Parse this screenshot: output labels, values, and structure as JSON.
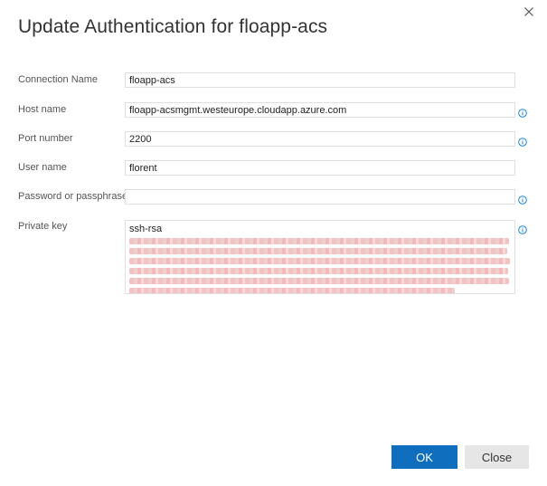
{
  "dialog": {
    "title": "Update Authentication for floapp-acs",
    "close_icon": "close-icon"
  },
  "fields": {
    "connection_name": {
      "label": "Connection Name",
      "value": "floapp-acs"
    },
    "host_name": {
      "label": "Host name",
      "value": "floapp-acsmgmt.westeurope.cloudapp.azure.com"
    },
    "port_number": {
      "label": "Port number",
      "value": "2200"
    },
    "user_name": {
      "label": "User name",
      "value": "florent"
    },
    "password": {
      "label": "Password or passphrase",
      "value": ""
    },
    "private_key": {
      "label": "Private key",
      "value_prefix": "ssh-rsa"
    }
  },
  "icons": {
    "info": "info-icon"
  },
  "buttons": {
    "ok": "OK",
    "close": "Close"
  },
  "colors": {
    "accent": "#106ebe",
    "info": "#1a86d0",
    "secondary_button": "#e6e6e6"
  }
}
